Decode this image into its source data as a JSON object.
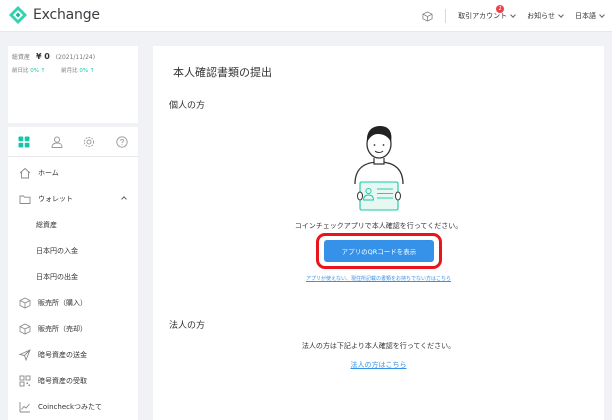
{
  "header": {
    "logo_text": "Exchange",
    "account_label": "取引アカウント",
    "account_badge": "2",
    "notice_label": "お知らせ",
    "lang_label": "日本語"
  },
  "sidebar": {
    "balance": {
      "label": "総資産",
      "amount": "¥ 0",
      "date": "(2021/11/24)",
      "day_label": "前日比",
      "day_value": "0% ↑",
      "month_label": "前月比",
      "month_value": "0% ↑"
    },
    "nav": {
      "home": "ホーム",
      "wallet": "ウォレット",
      "total_assets": "総資産",
      "jpy_deposit": "日本円の入金",
      "jpy_withdraw": "日本円の出金",
      "buy": "販売所（購入）",
      "sell": "販売所（売却）",
      "send": "暗号資産の送金",
      "receive": "暗号資産の受取",
      "tsumitate": "Coincheckつみたて"
    }
  },
  "main": {
    "title": "本人確認書類の提出",
    "individual_title": "個人の方",
    "individual_msg": "コインチェックアプリで本人確認を行ってください。",
    "qr_button": "アプリのQRコードを表示",
    "small_link": "アプリが使えない、現住所記載の書類をお持ちでない方はこちら",
    "corporate_title": "法人の方",
    "corporate_msg": "法人の方は下記より本人確認を行ってください。",
    "corporate_link": "法人の方はこちら"
  },
  "colors": {
    "accent": "#3592e8",
    "brand": "#18c6a7",
    "highlight": "#e8161c"
  }
}
